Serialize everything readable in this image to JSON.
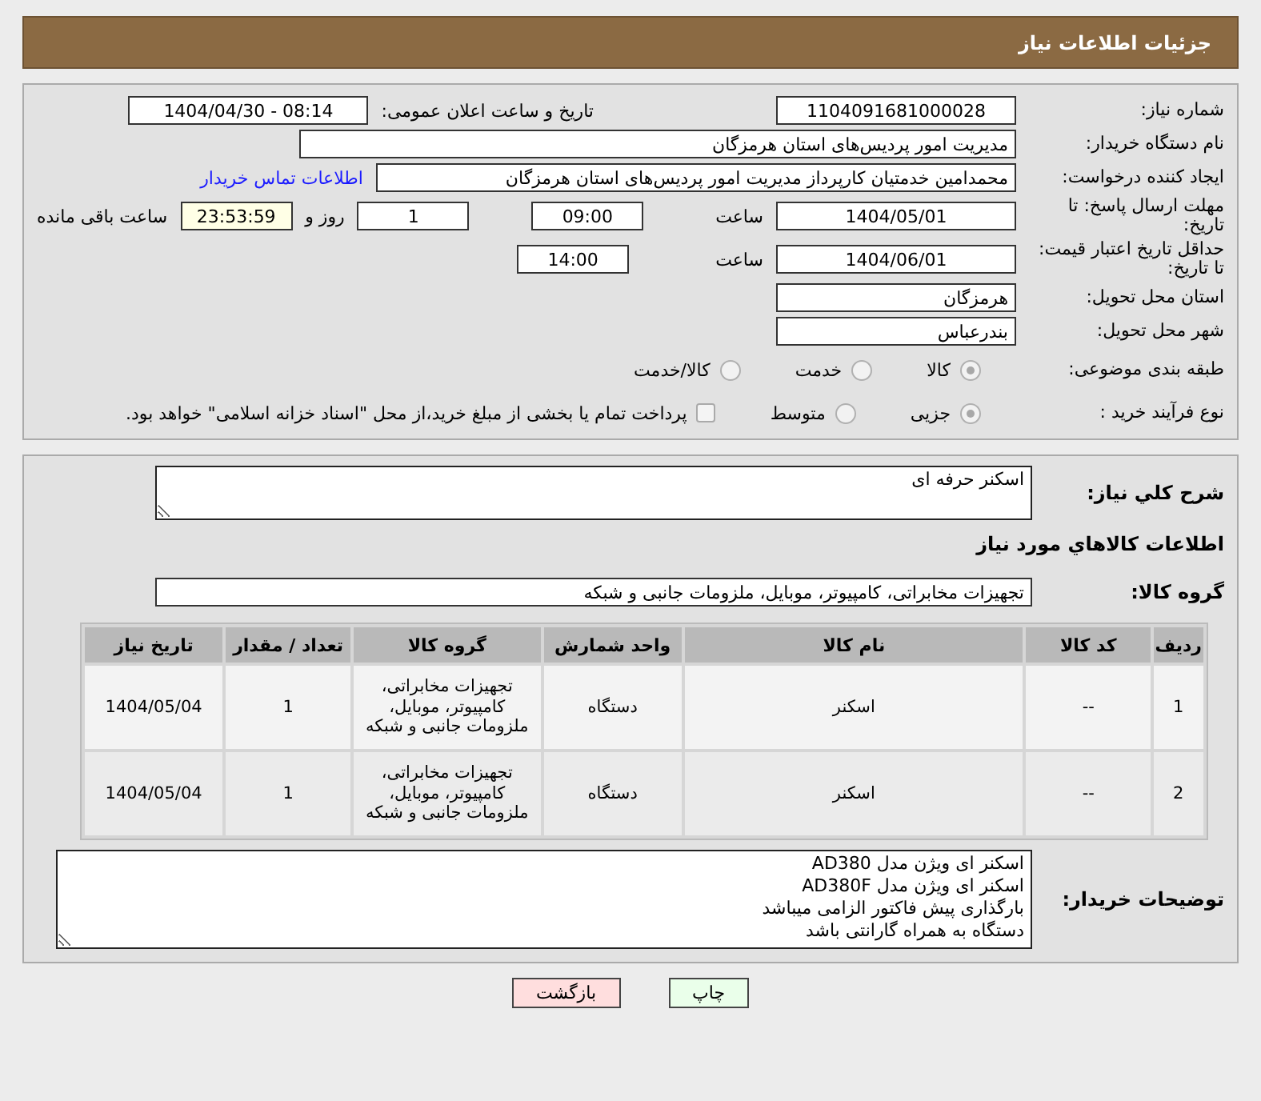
{
  "header": {
    "title": "جزئیات اطلاعات نیاز"
  },
  "need_number": {
    "label": "شماره نیاز:",
    "value": "1104091681000028"
  },
  "announce": {
    "label": "تاریخ و ساعت اعلان عمومی:",
    "value": "1404/04/30 - 08:14"
  },
  "buyer": {
    "label": "نام دستگاه خریدار:",
    "value": "مدیریت امور پردیس‌های استان هرمزگان"
  },
  "creator": {
    "label": "ایجاد کننده درخواست:",
    "value": "محمدامین خدمتیان کارپرداز مدیریت امور پردیس‌های استان هرمزگان",
    "link": "اطلاعات تماس خریدار"
  },
  "deadline": {
    "label": "مهلت ارسال پاسخ: تا تاریخ:",
    "date": "1404/05/01",
    "time_label": "ساعت",
    "time": "09:00",
    "days": "1",
    "days_label": "روز و",
    "remaining": "23:53:59",
    "remaining_label": "ساعت باقی مانده"
  },
  "validity": {
    "label": "حداقل تاریخ اعتبار قیمت: تا تاریخ:",
    "date": "1404/06/01",
    "time_label": "ساعت",
    "time": "14:00"
  },
  "province": {
    "label": "استان محل تحویل:",
    "value": "هرمزگان"
  },
  "city": {
    "label": "شهر محل تحویل:",
    "value": "بندرعباس"
  },
  "category": {
    "label": "طبقه بندی موضوعی:",
    "options": [
      {
        "label": "کالا",
        "selected": true
      },
      {
        "label": "خدمت",
        "selected": false
      },
      {
        "label": "کالا/خدمت",
        "selected": false
      }
    ]
  },
  "process": {
    "label": "نوع فرآیند خرید :",
    "options": [
      {
        "label": "جزیی",
        "selected": true
      },
      {
        "label": "متوسط",
        "selected": false
      }
    ],
    "treasury": {
      "label": "پرداخت تمام یا بخشی از مبلغ خرید،از محل \"اسناد خزانه اسلامی\" خواهد بود.",
      "checked": false
    }
  },
  "description": {
    "label": "شرح کلي نياز:",
    "value": "اسکنر حرفه ای"
  },
  "items_heading": "اطلاعات کالاهاي مورد نياز",
  "goods_group": {
    "label": "گروه کالا:",
    "value": "تجهیزات مخابراتی، کامپیوتر، موبایل، ملزومات جانبی و شبکه"
  },
  "table": {
    "columns": [
      "ردیف",
      "کد کالا",
      "نام کالا",
      "واحد شمارش",
      "گروه کالا",
      "تعداد / مقدار",
      "تاریخ نیاز"
    ],
    "rows": [
      [
        "1",
        "--",
        "اسکنر",
        "دستگاه",
        "تجهیزات مخابراتی، کامپیوتر، موبایل، ملزومات جانبی و شبکه",
        "1",
        "1404/05/04"
      ],
      [
        "2",
        "--",
        "اسکنر",
        "دستگاه",
        "تجهیزات مخابراتی، کامپیوتر، موبایل، ملزومات جانبی و شبکه",
        "1",
        "1404/05/04"
      ]
    ]
  },
  "buyer_notes": {
    "label": "توضیحات خریدار:",
    "lines": [
      "اسکنر ای ویژن مدل AD380",
      "اسکنر ای ویژن مدل AD380F",
      "بارگذاری پیش فاکتور الزامی میباشد",
      "دستگاه به همراه گارانتی باشد"
    ]
  },
  "buttons": [
    {
      "label": "چاپ",
      "kind": "print"
    },
    {
      "label": "بازگشت",
      "kind": "back"
    }
  ]
}
